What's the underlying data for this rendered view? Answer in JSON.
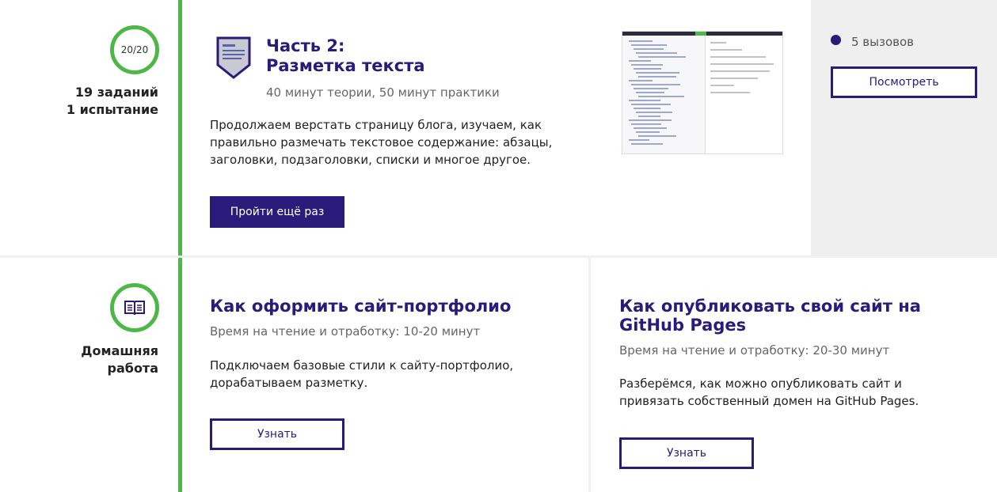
{
  "lesson": {
    "progress": "20/20",
    "tasks_line1": "19 заданий",
    "tasks_line2": "1 испытание",
    "title_line1": "Часть 2:",
    "title_line2": "Разметка текста",
    "meta": "40 минут теории, 50 минут практики",
    "description": "Продолжаем верстать страницу блога, изучаем, как правильно размечать текстовое содержание: абзацы, заголовки, подзаголовки, списки и многое другое.",
    "retry_button": "Пройти ещё раз",
    "icon": "document-shield-icon"
  },
  "sidebar": {
    "calls": "5 вызовов",
    "view_button": "Посмотреть"
  },
  "homework": {
    "label_line1": "Домашняя",
    "label_line2": "работа",
    "icon": "book-icon",
    "cards": [
      {
        "title": "Как оформить сайт-портфолио",
        "meta": "Время на чтение и отработку: 10-20 минут",
        "description": "Подключаем базовые стили к сайту-портфолио, дорабатываем разметку.",
        "button": "Узнать"
      },
      {
        "title": "Как опубликовать свой сайт на GitHub Pages",
        "meta": "Время на чтение и отработку: 20-30 минут",
        "description": "Разберёмся, как можно опубликовать сайт и привязать собственный домен на GitHub Pages.",
        "button": "Узнать"
      }
    ]
  },
  "colors": {
    "accent": "#2a1a7a",
    "timeline": "#4db847",
    "sidebar_bg": "#efefef"
  }
}
